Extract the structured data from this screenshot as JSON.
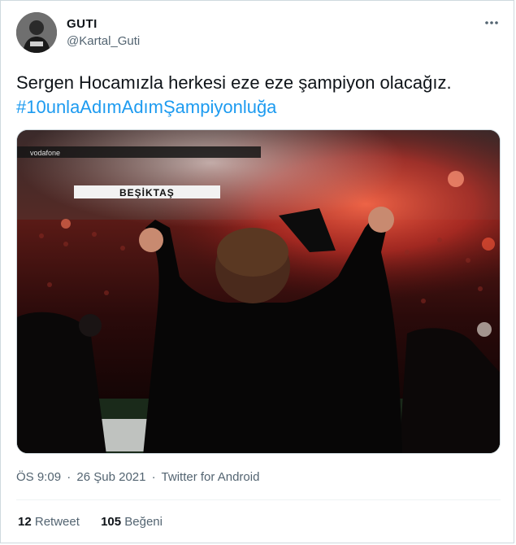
{
  "user": {
    "display_name": "GUTI",
    "handle": "@Kartal_Guti"
  },
  "tweet": {
    "text": "Sergen Hocamızla herkesi eze eze şampiyon olacağız.",
    "hashtag": "#10unlaAdımAdımŞampiyonluğa"
  },
  "media": {
    "banner_text": "BEŞİKTAŞ",
    "sponsor_text": "vodafone"
  },
  "meta": {
    "time": "ÖS 9:09",
    "date": "26 Şub 2021",
    "source": "Twitter for Android",
    "separator": "·"
  },
  "stats": {
    "retweets_count": "12",
    "retweets_label": "Retweet",
    "likes_count": "105",
    "likes_label": "Beğeni"
  },
  "colors": {
    "link": "#1d9bf0",
    "secondary_text": "#536471",
    "primary_text": "#0f1419",
    "border": "#cfd9de"
  },
  "icons": {
    "more": "more-dots-icon"
  }
}
